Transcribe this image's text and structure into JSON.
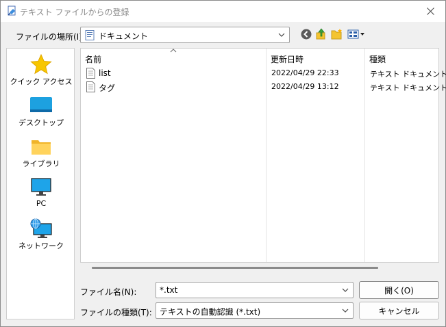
{
  "window": {
    "title": "テキスト ファイルからの登録",
    "close_icon": "close-icon"
  },
  "location": {
    "label": "ファイルの場所(I):",
    "value": "ドキュメント",
    "icons": [
      "back-icon",
      "up-folder-icon",
      "new-folder-icon",
      "view-menu-icon"
    ]
  },
  "places": [
    {
      "label": "クイック アクセス",
      "icon": "star-icon"
    },
    {
      "label": "デスクトップ",
      "icon": "desktop-icon"
    },
    {
      "label": "ライブラリ",
      "icon": "folder-icon"
    },
    {
      "label": "PC",
      "icon": "monitor-icon"
    },
    {
      "label": "ネットワーク",
      "icon": "network-icon"
    }
  ],
  "list": {
    "columns": [
      "名前",
      "更新日時",
      "種類"
    ],
    "rows": [
      {
        "name": "list",
        "date": "2022/04/29 22:33",
        "type": "テキスト ドキュメント"
      },
      {
        "name": "タグ",
        "date": "2022/04/29 13:12",
        "type": "テキスト ドキュメント"
      }
    ]
  },
  "filename": {
    "label": "ファイル名(N):",
    "value": "*.txt"
  },
  "filetype": {
    "label": "ファイルの種類(T):",
    "value": "テキストの自動認識 (*.txt)"
  },
  "buttons": {
    "open": "開く(O)",
    "cancel": "キャンセル"
  },
  "colors": {
    "accent": "#0078d7",
    "folder": "#f4c430",
    "star": "#f7c600"
  }
}
